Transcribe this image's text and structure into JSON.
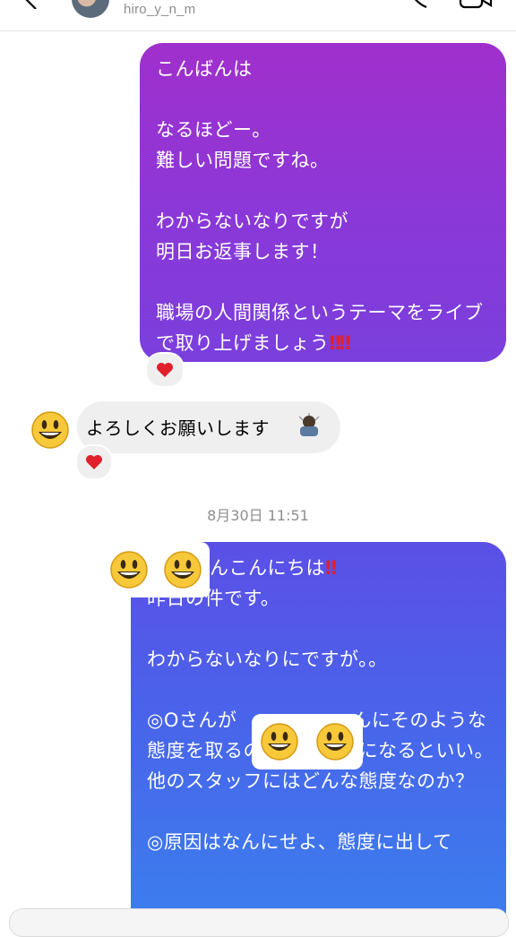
{
  "header": {
    "username": "hiro_y_n_m"
  },
  "messages": {
    "outgoing_1": {
      "text": "こんばんは\n\nなるほどー。\n難しい問題ですね。\n\nわからないなりですが\n明日お返事します！\n\n職場の人間関係というテーマをライブで取り上げましょう",
      "reaction": "heart"
    },
    "incoming_1": {
      "text": "よろしくお願いします",
      "reaction": "heart"
    },
    "timestamp": "8月30日 11:51",
    "outgoing_2": {
      "line1": "んこんにちは",
      "rest": "昨日の件です。\n\nわからないなりにですが。。\n\n◎Oさんが　　　　　　んにそのような態度を取るのかが明らかになるといい。他のスタッフにはどんな態度なのか？\n\n◎原因はなんにせよ、態度に出して"
    }
  },
  "colors": {
    "bubble_1_top": "#a02fcc",
    "bubble_1_bottom": "#7a3fdc",
    "bubble_2_top": "#5c4fe6",
    "bubble_2_bottom": "#3a80ee",
    "incoming_bubble": "#efefef",
    "heart": "#e0202a"
  }
}
